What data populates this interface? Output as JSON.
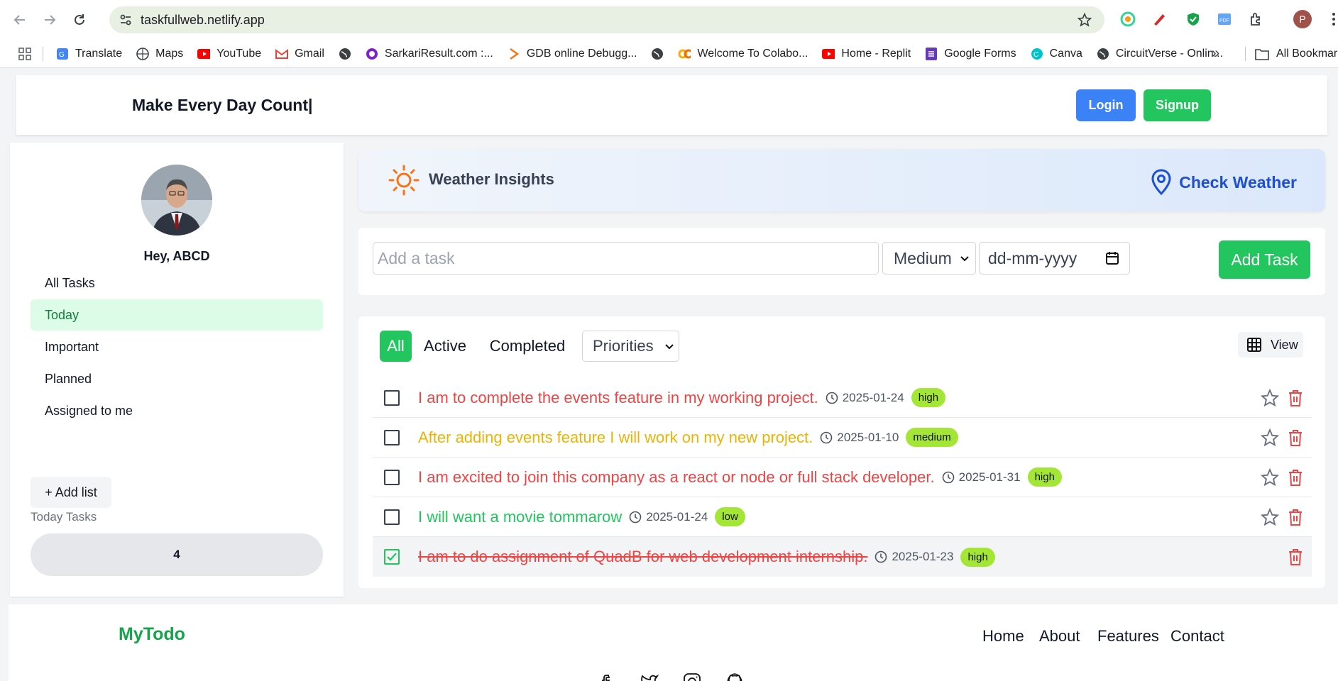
{
  "browser": {
    "url": "taskfullweb.netlify.app",
    "profile_initial": "P",
    "bookmarks": [
      {
        "label": "Translate",
        "icon": "google-translate-icon"
      },
      {
        "label": "Maps",
        "icon": "maps-icon"
      },
      {
        "label": "YouTube",
        "icon": "youtube-icon"
      },
      {
        "label": "Gmail",
        "icon": "gmail-icon"
      },
      {
        "label": "",
        "icon": "globe-icon"
      },
      {
        "label": "SarkariResult.com :...",
        "icon": "sarkari-icon"
      },
      {
        "label": "GDB online Debugg...",
        "icon": "gdb-icon"
      },
      {
        "label": "",
        "icon": "globe-icon"
      },
      {
        "label": "Welcome To Colabo...",
        "icon": "colab-icon"
      },
      {
        "label": "Home - Replit",
        "icon": "youtube-icon"
      },
      {
        "label": "Google Forms",
        "icon": "forms-icon"
      },
      {
        "label": "Canva",
        "icon": "canva-icon"
      },
      {
        "label": "CircuitVerse - Onlin...",
        "icon": "globe-icon"
      }
    ],
    "more": "»",
    "all_bookmarks": "All Bookmarks"
  },
  "header": {
    "title": "Make Every Day Count|",
    "login": "Login",
    "signup": "Signup"
  },
  "sidebar": {
    "greeting": "Hey, ABCD",
    "items": [
      {
        "label": "All Tasks",
        "active": false
      },
      {
        "label": "Today",
        "active": true
      },
      {
        "label": "Important",
        "active": false
      },
      {
        "label": "Planned",
        "active": false
      },
      {
        "label": "Assigned to me",
        "active": false
      }
    ],
    "add_list": "+ Add list",
    "today_tasks_label": "Today Tasks",
    "today_tasks_count": "4"
  },
  "weather": {
    "title": "Weather Insights",
    "check": "Check Weather"
  },
  "add_task": {
    "placeholder": "Add a task",
    "priority": "Medium",
    "date_placeholder": "dd-mm-yyyy",
    "button": "Add Task"
  },
  "filters": {
    "tabs": [
      "All",
      "Active",
      "Completed"
    ],
    "active_tab": "All",
    "priorities": "Priorities",
    "view": "View"
  },
  "tasks": [
    {
      "text": "I am to complete the events feature in my working project.",
      "date": "2025-01-24",
      "priority": "high",
      "color": "#ef4444",
      "done": false
    },
    {
      "text": "After adding events feature I will work on my new project.",
      "date": "2025-01-10",
      "priority": "medium",
      "color": "#eab308",
      "done": false
    },
    {
      "text": "I am excited to join this company as a react or node or full stack developer.",
      "date": "2025-01-31",
      "priority": "high",
      "color": "#ef4444",
      "done": false
    },
    {
      "text": "I will want a movie tommarow",
      "date": "2025-01-24",
      "priority": "low",
      "color": "#22c55e",
      "done": false
    },
    {
      "text": "I am to do assignment of QuadB for web development internship.",
      "date": "2025-01-23",
      "priority": "high",
      "color": "#ef4444",
      "done": true
    }
  ],
  "footer": {
    "brand": "MyTodo",
    "links": [
      "Home",
      "About",
      "Features",
      "Contact"
    ]
  },
  "colors": {
    "accent_green": "#22c55e",
    "login_blue": "#3b82f6",
    "weather_blue": "#1d4ed8",
    "weather_sun": "#f97316"
  }
}
